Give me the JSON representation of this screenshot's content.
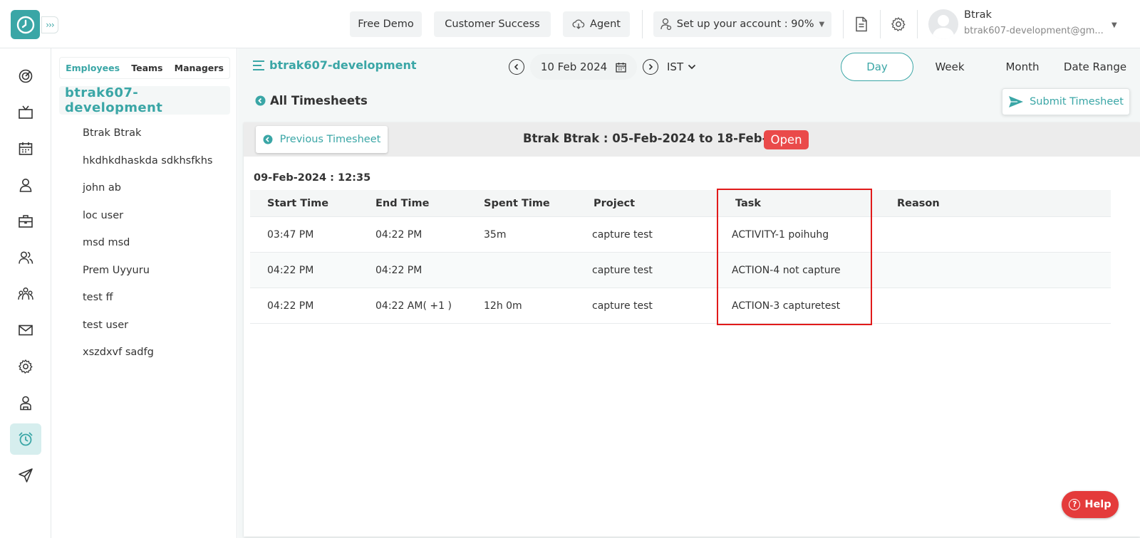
{
  "header": {
    "buttons": {
      "free_demo": "Free Demo",
      "customer_success": "Customer Success",
      "agent": "Agent",
      "setup": "Set up your account : 90%"
    },
    "user": {
      "name": "Btrak",
      "email": "btrak607-development@gm..."
    }
  },
  "employee_panel": {
    "tabs": [
      "Employees",
      "Teams",
      "Managers"
    ],
    "active_tab": "Employees",
    "org_name": "btrak607-development",
    "employees": [
      "Btrak Btrak",
      "hkdhkdhaskda sdkhsfkhs",
      "john ab",
      "loc user",
      "msd msd",
      "Prem Uyyuru",
      "test ff",
      "test user",
      "xszdxvf sadfg"
    ]
  },
  "main": {
    "breadcrumb": "btrak607-development",
    "date": "10 Feb 2024",
    "timezone": "IST",
    "periods": [
      "Day",
      "Week",
      "Month",
      "Date Range"
    ],
    "active_period": "Day",
    "all_timesheets": "All Timesheets",
    "submit_label": "Submit Timesheet",
    "previous_label": "Previous Timesheet",
    "timesheet_title": "Btrak Btrak : 05-Feb-2024 to 18-Feb-2024",
    "status": "Open",
    "entry_date": "09-Feb-2024 : 12:35",
    "table": {
      "columns": [
        "Start Time",
        "End Time",
        "Spent Time",
        "Project",
        "Task",
        "Reason"
      ],
      "rows": [
        [
          "03:47 PM",
          "04:22 PM",
          "35m",
          "capture test",
          "ACTIVITY-1 poihuhg",
          ""
        ],
        [
          "04:22 PM",
          "04:22 PM",
          "",
          "capture test",
          "ACTION-4 not capture",
          ""
        ],
        [
          "04:22 PM",
          "04:22 AM( +1 )",
          "12h 0m",
          "capture test",
          "ACTION-3 capturetest",
          ""
        ]
      ]
    },
    "help_label": "Help"
  },
  "colors": {
    "accent": "#3aa6a6",
    "status_open": "#ea4a4a",
    "highlight_box": "#e11a1a",
    "help": "#e43b3b"
  }
}
